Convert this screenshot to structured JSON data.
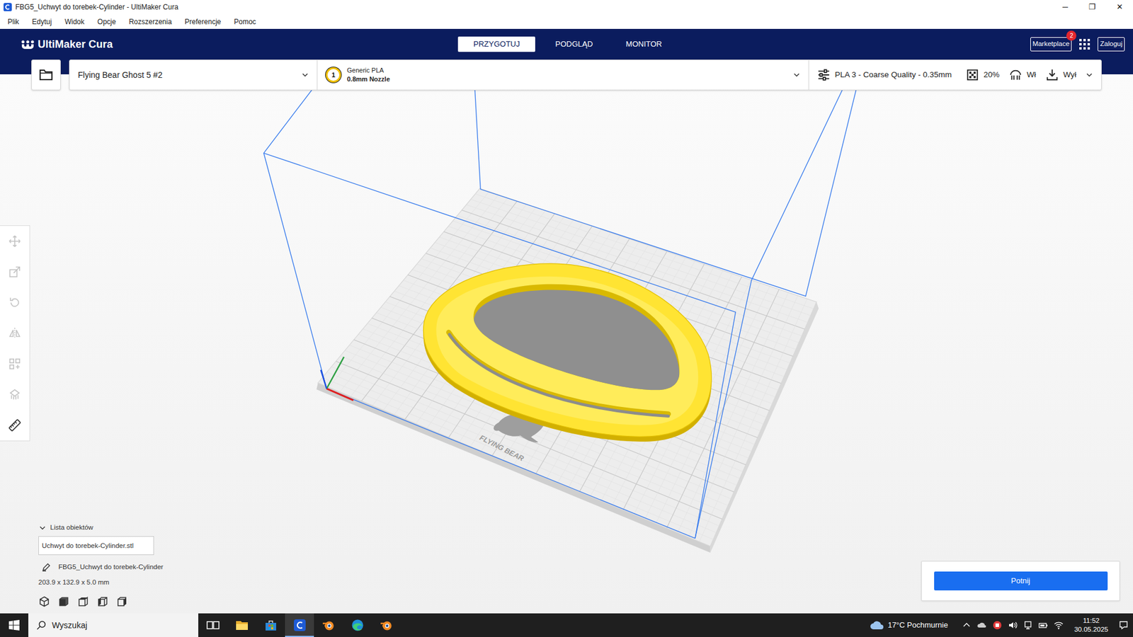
{
  "window": {
    "title": "FBG5_Uchwyt do torebek-Cylinder - UltiMaker Cura",
    "controls": [
      "─",
      "❐",
      "✕"
    ]
  },
  "menu": [
    "Plik",
    "Edytuj",
    "Widok",
    "Opcje",
    "Rozszerzenia",
    "Preferencje",
    "Pomoc"
  ],
  "header": {
    "logo": "UltiMaker Cura",
    "tabs": [
      {
        "label": "PRZYGOTUJ",
        "selected": true
      },
      {
        "label": "PODGLĄD",
        "selected": false
      },
      {
        "label": "MONITOR",
        "selected": false
      }
    ],
    "marketplace": {
      "label": "Marketplace",
      "badge": "2"
    },
    "login": "Zaloguj"
  },
  "toolbar": {
    "printer": "Flying Bear Ghost 5 #2",
    "extruder": "1",
    "material": "Generic PLA",
    "nozzle": "0.8mm Nozzle",
    "profile": "PLA 3 - Coarse Quality - 0.35mm",
    "infill": "20%",
    "support": "Wł",
    "adhesion": "Wył"
  },
  "tools": [
    {
      "kind": "move",
      "disabled": true
    },
    {
      "kind": "scale",
      "disabled": true
    },
    {
      "kind": "rotate",
      "disabled": true
    },
    {
      "kind": "mirror",
      "disabled": true
    },
    {
      "kind": "arrange",
      "disabled": true
    },
    {
      "kind": "support",
      "disabled": true
    },
    {
      "kind": "measure",
      "disabled": false
    }
  ],
  "scene": {
    "plate_logo": "FLYING BEAR"
  },
  "objects": {
    "title": "Lista obiektów",
    "expanded": true,
    "items": [
      "Uchwyt do torebek-Cylinder.stl"
    ],
    "job_name": "FBG5_Uchwyt do torebek-Cylinder",
    "dimensions": "203.9 x 132.9 x 5.0 mm"
  },
  "slice": {
    "button": "Potnij"
  },
  "taskbar": {
    "search": "Wyszukaj",
    "apps": [
      {
        "kind": "taskview",
        "selected": false
      },
      {
        "kind": "explorer",
        "selected": false
      },
      {
        "kind": "store",
        "selected": false
      },
      {
        "kind": "cura",
        "selected": true
      },
      {
        "kind": "blender",
        "selected": false
      },
      {
        "kind": "edge",
        "selected": false
      },
      {
        "kind": "blender",
        "selected": false
      }
    ],
    "weather": "17°C Pochmurnie",
    "time": "11:52",
    "date": "30.05.2025"
  }
}
